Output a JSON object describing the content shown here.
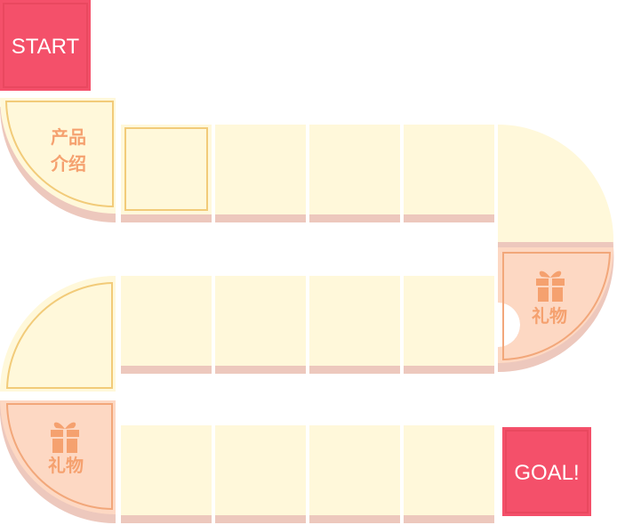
{
  "board": {
    "start_label": "START",
    "goal_label": "GOAL!",
    "intro_line1": "产品",
    "intro_line2": "介绍",
    "gift1_label": "礼物",
    "gift2_label": "礼物",
    "gift_icon": "gift-icon",
    "colors": {
      "tile_fill": "#fff8da",
      "tile_shadow": "#edc8bd",
      "gift_fill": "#fdd8c3",
      "border": "#f2cb79",
      "gift_border": "#f2a77a",
      "label": "#f5a16f",
      "sign_fill": "#f4506a",
      "sign_border": "#e9485f"
    }
  }
}
